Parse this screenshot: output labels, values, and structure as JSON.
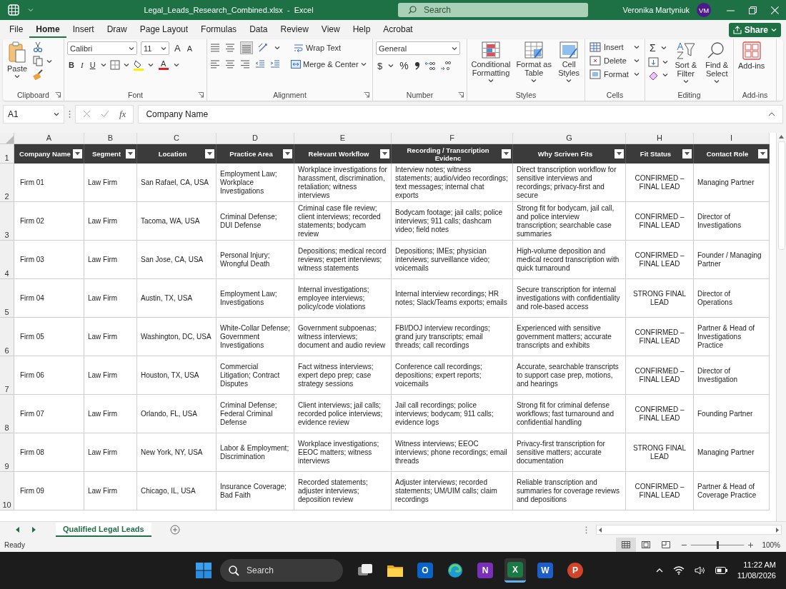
{
  "window": {
    "title": "Legal_Leads_Research_Combined.xlsx  -  Excel",
    "search_placeholder": "Search",
    "user": "Veronika Martyniuk",
    "avatar_initials": "VM"
  },
  "menu_tabs": [
    {
      "label": "File",
      "selected": false
    },
    {
      "label": "Home",
      "selected": true
    },
    {
      "label": "Insert",
      "selected": false
    },
    {
      "label": "Draw",
      "selected": false
    },
    {
      "label": "Page Layout",
      "selected": false
    },
    {
      "label": "Formulas",
      "selected": false
    },
    {
      "label": "Data",
      "selected": false
    },
    {
      "label": "Review",
      "selected": false
    },
    {
      "label": "View",
      "selected": false
    },
    {
      "label": "Help",
      "selected": false
    },
    {
      "label": "Acrobat",
      "selected": false
    }
  ],
  "share_button": "Share",
  "ribbon": {
    "clipboard": {
      "paste": "Paste",
      "label": "Clipboard"
    },
    "font": {
      "font_name": "Calibri",
      "font_size": "11",
      "grow": "A",
      "shrink": "A",
      "bold": "B",
      "italic": "I",
      "underline": "U",
      "font_color": "A",
      "label": "Font"
    },
    "alignment": {
      "wrap_text": "Wrap Text",
      "merge_center": "Merge & Center",
      "label": "Alignment"
    },
    "number": {
      "format": "General",
      "currency": "$",
      "percent": "%",
      "label": "Number"
    },
    "styles": {
      "items": [
        "Conditional Formatting",
        "Format as Table",
        "Cell Styles"
      ],
      "label": "Styles"
    },
    "cells": {
      "items": [
        "Insert",
        "Delete",
        "Format"
      ],
      "label": "Cells"
    },
    "editing": {
      "sum": "Σ",
      "items": [
        "Sort & Filter",
        "Find & Select"
      ],
      "label": "Editing"
    },
    "addins": {
      "button": "Add-ins",
      "label": "Add-ins"
    }
  },
  "formula_bar": {
    "name_box": "A1",
    "fx": "fx",
    "content": "Company Name"
  },
  "sheet": {
    "columns": [
      {
        "letter": "A",
        "heading": "Company Name"
      },
      {
        "letter": "B",
        "heading": "Segment"
      },
      {
        "letter": "C",
        "heading": "Location"
      },
      {
        "letter": "D",
        "heading": "Practice Area"
      },
      {
        "letter": "E",
        "heading": "Relevant Workflow"
      },
      {
        "letter": "F",
        "heading": "Recording / Transcription Evidenc"
      },
      {
        "letter": "G",
        "heading": "Why Scriven Fits"
      },
      {
        "letter": "H",
        "heading": "Fit Status"
      },
      {
        "letter": "I",
        "heading": "Contact Role"
      }
    ],
    "header_row_number": "1",
    "rows": [
      {
        "number": "2",
        "cells": [
          "Firm 01",
          "Law Firm",
          "San Rafael, CA, USA",
          "Employment Law; Workplace Investigations",
          "Workplace investigations for harassment, discrimination, retaliation; witness interviews",
          "Interview notes; witness statements; audio/video recordings; text messages; internal chat exports",
          "Direct transcription workflow for sensitive interviews and recordings; privacy-first and secure",
          "CONFIRMED – FINAL LEAD",
          "Managing Partner"
        ]
      },
      {
        "number": "3",
        "cells": [
          "Firm 02",
          "Law Firm",
          "Tacoma, WA, USA",
          "Criminal Defense; DUI Defense",
          "Criminal case file review; client interviews; recorded statements; bodycam review",
          "Bodycam footage; jail calls; police interviews; 911 calls; dashcam video; field notes",
          "Strong fit for bodycam, jail call, and police interview transcription; searchable case summaries",
          "CONFIRMED – FINAL LEAD",
          "Director of Investigations"
        ]
      },
      {
        "number": "4",
        "cells": [
          "Firm 03",
          "Law Firm",
          "San Jose, CA, USA",
          "Personal Injury; Wrongful Death",
          "Depositions; medical record reviews; expert interviews; witness statements",
          "Depositions; IMEs; physician interviews; surveillance video; voicemails",
          "High-volume deposition and medical record transcription with quick turnaround",
          "CONFIRMED – FINAL LEAD",
          "Founder / Managing Partner"
        ]
      },
      {
        "number": "5",
        "cells": [
          "Firm 04",
          "Law Firm",
          "Austin, TX, USA",
          "Employment Law; Investigations",
          "Internal investigations; employee interviews; policy/code violations",
          "Internal interview recordings; HR notes; Slack/Teams exports; emails",
          "Secure transcription for internal investigations with confidentiality and role-based access",
          "STRONG FINAL LEAD",
          "Director of Operations"
        ]
      },
      {
        "number": "6",
        "cells": [
          "Firm 05",
          "Law Firm",
          "Washington, DC, USA",
          "White-Collar Defense; Government Investigations",
          "Government subpoenas; witness interviews; document and audio review",
          "FBI/DOJ interview recordings; grand jury transcripts; email threads; call recordings",
          "Experienced with sensitive government matters; accurate transcripts and exhibits",
          "CONFIRMED – FINAL LEAD",
          "Partner & Head of Investigations Practice"
        ]
      },
      {
        "number": "7",
        "cells": [
          "Firm 06",
          "Law Firm",
          "Houston, TX, USA",
          "Commercial Litigation; Contract Disputes",
          "Fact witness interviews; expert depo prep; case strategy sessions",
          "Conference call recordings; depositions; expert reports; voicemails",
          "Accurate, searchable transcripts to support case prep, motions, and hearings",
          "CONFIRMED – FINAL LEAD",
          "Director of Investigation"
        ]
      },
      {
        "number": "8",
        "cells": [
          "Firm 07",
          "Law Firm",
          "Orlando, FL, USA",
          "Criminal Defense; Federal Criminal Defense",
          "Client interviews; jail calls; recorded police interviews; evidence review",
          "Jail call recordings; police interviews; bodycam; 911 calls; evidence logs",
          "Strong fit for criminal defense workflows; fast turnaround and confidential handling",
          "CONFIRMED – FINAL LEAD",
          "Founding Partner"
        ]
      },
      {
        "number": "9",
        "cells": [
          "Firm 08",
          "Law Firm",
          "New York, NY, USA",
          "Labor & Employment; Discrimination",
          "Workplace investigations; EEOC matters; witness interviews",
          "Witness interviews; EEOC interviews; phone recordings; email threads",
          "Privacy-first transcription for sensitive matters; accurate documentation",
          "STRONG FINAL LEAD",
          "Managing Partner"
        ]
      },
      {
        "number": "10",
        "cells": [
          "Firm 09",
          "Law Firm",
          "Chicago, IL, USA",
          "Insurance Coverage; Bad Faith",
          "Recorded statements; adjuster interviews; deposition review",
          "Adjuster interviews; recorded statements; UM/UIM calls; claim recordings",
          "Reliable transcription and summaries for coverage reviews and depositions",
          "CONFIRMED – FINAL LEAD",
          "Partner & Head of Coverage Practice"
        ]
      }
    ]
  },
  "sheet_tabs": [
    {
      "label": "Qualified Legal Leads",
      "selected": true
    }
  ],
  "status_bar": {
    "text": "Ready",
    "views": [
      {
        "kind": "normal",
        "selected": true
      },
      {
        "kind": "page-layout",
        "selected": false
      },
      {
        "kind": "page-break",
        "selected": false
      }
    ],
    "zoom_slider": {
      "level": 0.5
    },
    "zoom": "100%"
  },
  "taskbar": {
    "search": "Search",
    "apps": [
      {
        "kind": "task-view",
        "selected": false
      },
      {
        "kind": "folder",
        "selected": false
      },
      {
        "kind": "mail",
        "letter": "O",
        "selected": false
      },
      {
        "kind": "browser",
        "selected": false
      },
      {
        "kind": "notes",
        "letter": "N",
        "selected": false
      },
      {
        "kind": "sheet",
        "letter": "X",
        "selected": true
      },
      {
        "kind": "doc",
        "letter": "W",
        "selected": false
      },
      {
        "kind": "slides",
        "letter": "P",
        "selected": false
      }
    ],
    "time": "11:22 AM",
    "date": "11/08/2026"
  }
}
